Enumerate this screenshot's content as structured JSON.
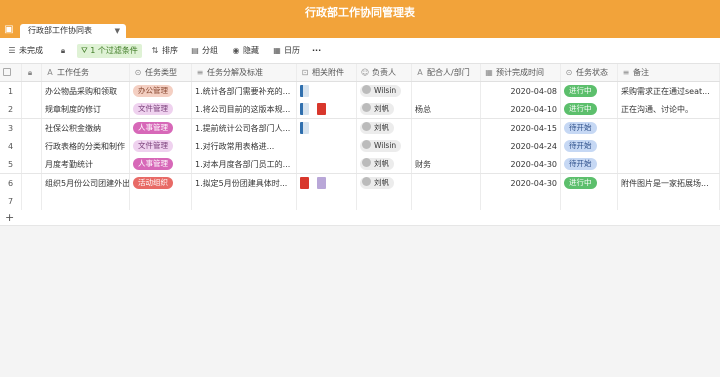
{
  "app": {
    "title": "行政部工作协同管理表"
  },
  "tabs": [
    {
      "label": "行政部工作协同表",
      "caret": "▼"
    }
  ],
  "toolbar": {
    "items": [
      {
        "label": "未完成",
        "icon": "grid-icon"
      },
      {
        "label": "",
        "icon": "lock-icon"
      },
      {
        "label": "1 个过滤条件",
        "icon": "filter-icon"
      },
      {
        "label": "排序",
        "icon": "sort-icon"
      },
      {
        "label": "分组",
        "icon": "group-icon"
      },
      {
        "label": "隐藏",
        "icon": "eye-icon"
      },
      {
        "label": "日历",
        "icon": "calendar-icon"
      },
      {
        "label": "···",
        "icon": "more-icon"
      }
    ]
  },
  "columns": [
    {
      "label": "工作任务",
      "icon": "A"
    },
    {
      "label": "任务类型",
      "icon": "⊙"
    },
    {
      "label": "任务分解及标准",
      "icon": "≡"
    },
    {
      "label": "相关附件",
      "icon": "⊡"
    },
    {
      "label": "负责人",
      "icon": "☺"
    },
    {
      "label": "配合人/部门",
      "icon": "A"
    },
    {
      "label": "预计完成时间",
      "icon": "▦"
    },
    {
      "label": "任务状态",
      "icon": "⊙"
    },
    {
      "label": "备注",
      "icon": "≡"
    }
  ],
  "rows": [
    {
      "num": "1",
      "task": "办公物品采购和领取",
      "type": "办公管理",
      "detail": "1.统计各部门需要补充的...",
      "files": [
        "doc"
      ],
      "owner": "Wilsin",
      "partner": "",
      "due": "2020-04-08",
      "status": "进行中",
      "note": "采购需求正在通过seat..."
    },
    {
      "num": "2",
      "task": "规章制度的修订",
      "type": "文件管理",
      "detail": "1.将公司目前的这版本规...",
      "files": [
        "doc",
        "pdf"
      ],
      "owner": "刘帆",
      "partner": "杨总",
      "due": "2020-04-10",
      "status": "进行中",
      "note": "正在沟通、讨论中。"
    },
    {
      "num": "3",
      "task": "社保公积金缴纳",
      "type": "人事管理",
      "detail": "1.提前统计公司各部门人...",
      "files": [
        "doc"
      ],
      "owner": "刘帆",
      "partner": "",
      "due": "2020-04-15",
      "status": "待开始",
      "note": ""
    },
    {
      "num": "4",
      "task": "行政表格的分类和制作",
      "type": "文件管理",
      "detail": "1.对行政常用表格进...",
      "files": [],
      "owner": "Wilsin",
      "partner": "",
      "due": "2020-04-24",
      "status": "待开始",
      "note": ""
    },
    {
      "num": "5",
      "task": "月度考勤统计",
      "type": "人事管理",
      "detail": "1.对本月度各部门员工的...",
      "files": [],
      "owner": "刘帆",
      "partner": "财务",
      "due": "2020-04-30",
      "status": "待开始",
      "note": ""
    },
    {
      "num": "6",
      "task": "组织5月份公司团建外出",
      "type": "活动组织",
      "detail": "1.拟定5月份团建具体时...",
      "files": [
        "pdf",
        "img"
      ],
      "owner": "刘帆",
      "partner": "",
      "due": "2020-04-30",
      "status": "进行中",
      "note": "附件图片是一家拓展场..."
    },
    {
      "num": "7",
      "task": "",
      "type": "",
      "detail": "",
      "files": [],
      "owner": "",
      "partner": "",
      "due": "",
      "status": "",
      "note": ""
    }
  ],
  "add_row": {
    "label": "+"
  },
  "colors": {
    "header_bg": "#f2a33a",
    "type_office": "#f4cfc2",
    "type_file": "#efd2ef",
    "type_hr": "#d768b8",
    "type_event": "#e86a66",
    "status_progress": "#5cbf6c",
    "status_pending": "#c6d8f4"
  }
}
